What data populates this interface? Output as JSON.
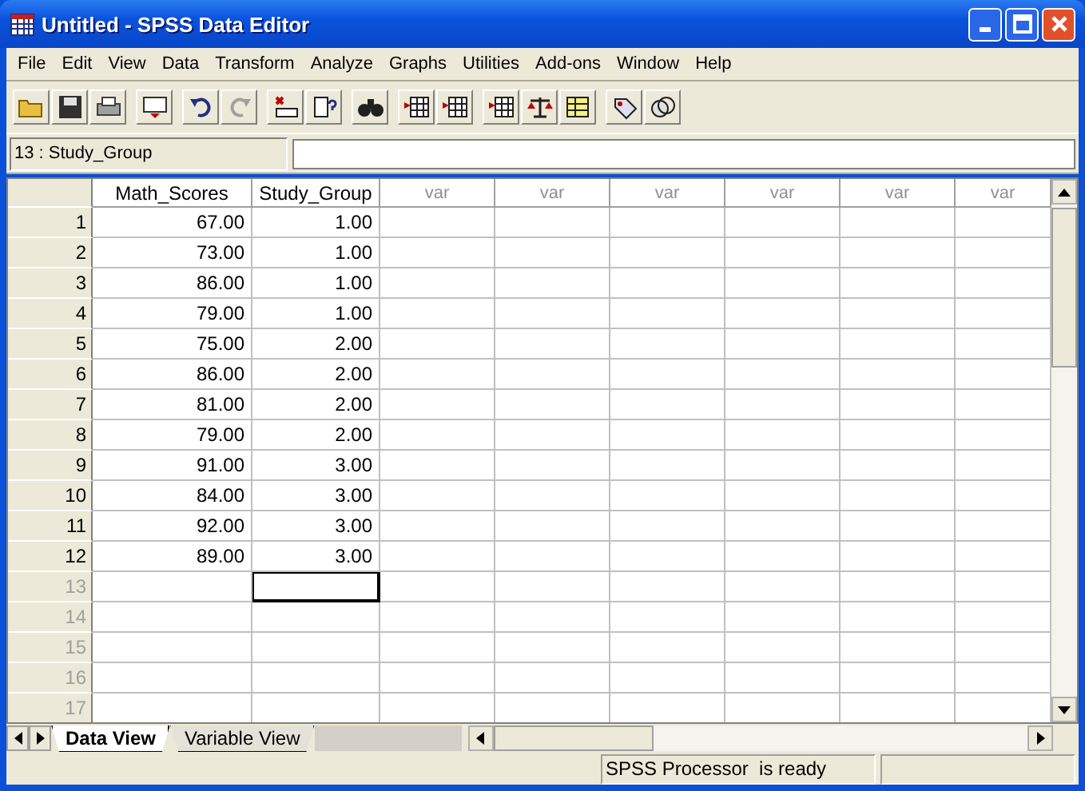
{
  "window": {
    "title": "Untitled - SPSS Data Editor"
  },
  "menu": [
    "File",
    "Edit",
    "View",
    "Data",
    "Transform",
    "Analyze",
    "Graphs",
    "Utilities",
    "Add-ons",
    "Window",
    "Help"
  ],
  "cell_reference": "13 : Study_Group",
  "columns": [
    {
      "label": "Math_Scores",
      "defined": true
    },
    {
      "label": "Study_Group",
      "defined": true
    },
    {
      "label": "var",
      "defined": false
    },
    {
      "label": "var",
      "defined": false
    },
    {
      "label": "var",
      "defined": false
    },
    {
      "label": "var",
      "defined": false
    },
    {
      "label": "var",
      "defined": false
    },
    {
      "label": "var",
      "defined": false
    }
  ],
  "rows": [
    {
      "number": "1",
      "filled": true,
      "cells": [
        {
          "value": "67.00",
          "selected": false
        },
        {
          "value": "1.00",
          "selected": false
        }
      ]
    },
    {
      "number": "2",
      "filled": true,
      "cells": [
        {
          "value": "73.00",
          "selected": false
        },
        {
          "value": "1.00",
          "selected": false
        }
      ]
    },
    {
      "number": "3",
      "filled": true,
      "cells": [
        {
          "value": "86.00",
          "selected": false
        },
        {
          "value": "1.00",
          "selected": false
        }
      ]
    },
    {
      "number": "4",
      "filled": true,
      "cells": [
        {
          "value": "79.00",
          "selected": false
        },
        {
          "value": "1.00",
          "selected": false
        }
      ]
    },
    {
      "number": "5",
      "filled": true,
      "cells": [
        {
          "value": "75.00",
          "selected": false
        },
        {
          "value": "2.00",
          "selected": false
        }
      ]
    },
    {
      "number": "6",
      "filled": true,
      "cells": [
        {
          "value": "86.00",
          "selected": false
        },
        {
          "value": "2.00",
          "selected": false
        }
      ]
    },
    {
      "number": "7",
      "filled": true,
      "cells": [
        {
          "value": "81.00",
          "selected": false
        },
        {
          "value": "2.00",
          "selected": false
        }
      ]
    },
    {
      "number": "8",
      "filled": true,
      "cells": [
        {
          "value": "79.00",
          "selected": false
        },
        {
          "value": "2.00",
          "selected": false
        }
      ]
    },
    {
      "number": "9",
      "filled": true,
      "cells": [
        {
          "value": "91.00",
          "selected": false
        },
        {
          "value": "3.00",
          "selected": false
        }
      ]
    },
    {
      "number": "10",
      "filled": true,
      "cells": [
        {
          "value": "84.00",
          "selected": false
        },
        {
          "value": "3.00",
          "selected": false
        }
      ]
    },
    {
      "number": "11",
      "filled": true,
      "cells": [
        {
          "value": "92.00",
          "selected": false
        },
        {
          "value": "3.00",
          "selected": false
        }
      ]
    },
    {
      "number": "12",
      "filled": true,
      "cells": [
        {
          "value": "89.00",
          "selected": false
        },
        {
          "value": "3.00",
          "selected": false
        }
      ]
    },
    {
      "number": "13",
      "filled": false,
      "cells": [
        {
          "selected": false
        },
        {
          "selected": true
        }
      ]
    },
    {
      "number": "14",
      "filled": false,
      "cells": [
        {
          "selected": false
        },
        {
          "selected": false
        }
      ]
    },
    {
      "number": "15",
      "filled": false,
      "cells": [
        {
          "selected": false
        },
        {
          "selected": false
        }
      ]
    },
    {
      "number": "16",
      "filled": false,
      "cells": [
        {
          "selected": false
        },
        {
          "selected": false
        }
      ]
    },
    {
      "number": "17",
      "filled": false,
      "cells": [
        {
          "selected": false
        },
        {
          "selected": false
        }
      ]
    }
  ],
  "tabs": [
    {
      "label": "Data View",
      "selected": true
    },
    {
      "label": "Variable View",
      "selected": false
    }
  ],
  "status_bar": {
    "text": "SPSS Processor  is ready"
  }
}
